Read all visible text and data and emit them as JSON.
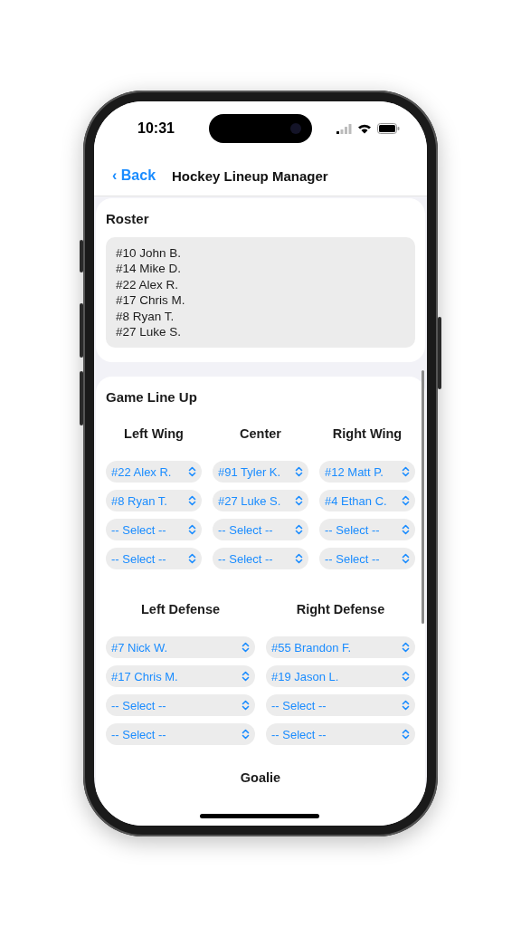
{
  "status_bar": {
    "time": "10:31"
  },
  "nav_bar": {
    "back": "‹ Back",
    "title": "Hockey Lineup Manager"
  },
  "roster": {
    "title": "Roster",
    "lines": [
      "#10 John B.",
      "#14 Mike D.",
      "#22 Alex R.",
      "#17 Chris M.",
      "#8 Ryan T.",
      "#27 Luke S."
    ]
  },
  "lineup": {
    "title": "Game Line Up",
    "forwards": [
      {
        "heading": "Left Wing",
        "slots": [
          "#22 Alex R.",
          "#8 Ryan T.",
          "-- Select --",
          "-- Select --"
        ]
      },
      {
        "heading": "Center",
        "slots": [
          "#91 Tyler K.",
          "#27 Luke S.",
          "-- Select --",
          "-- Select --"
        ]
      },
      {
        "heading": "Right Wing",
        "slots": [
          "#12 Matt P.",
          "#4 Ethan C.",
          "-- Select --",
          "-- Select --"
        ]
      }
    ],
    "defense": [
      {
        "heading": "Left Defense",
        "slots": [
          "#7 Nick W.",
          "#17 Chris M.",
          "-- Select --",
          "-- Select --"
        ]
      },
      {
        "heading": "Right Defense",
        "slots": [
          "#55 Brandon F.",
          "#19 Jason L.",
          "-- Select --",
          "-- Select --"
        ]
      }
    ],
    "goalie": {
      "heading": "Goalie"
    }
  }
}
